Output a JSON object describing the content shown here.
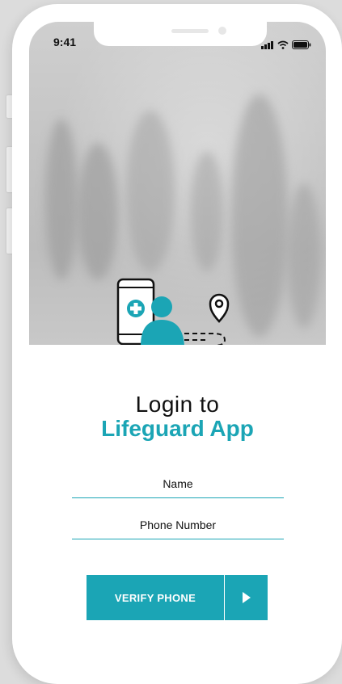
{
  "status_bar": {
    "time": "9:41"
  },
  "login": {
    "title_line1": "Login to",
    "title_line2": "Lifeguard App"
  },
  "form": {
    "name_placeholder": "Name",
    "phone_placeholder": "Phone Number",
    "verify_label": "VERIFY PHONE"
  },
  "icons": {
    "signal": "cellular-signal-icon",
    "wifi": "wifi-icon",
    "battery": "battery-icon",
    "illustration": "phone-user-location-illustration",
    "arrow": "play-arrow-icon"
  },
  "colors": {
    "accent": "#1ba5b5"
  }
}
